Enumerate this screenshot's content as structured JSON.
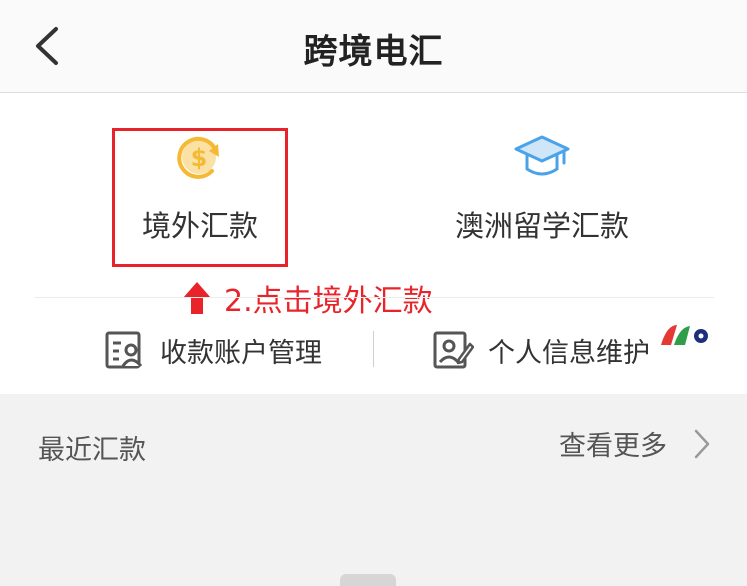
{
  "header": {
    "title": "跨境电汇",
    "back_icon": "chevron-left-icon"
  },
  "services": [
    {
      "label": "境外汇款",
      "icon": "dollar-cycle-icon",
      "color": "#f5b935"
    },
    {
      "label": "澳洲留学汇款",
      "icon": "graduation-cap-icon",
      "color": "#4aa3e8"
    }
  ],
  "annotation": {
    "text": "2.点击境外汇款",
    "color": "#e8242a",
    "icon": "arrow-up-icon"
  },
  "links": [
    {
      "label": "收款账户管理",
      "icon": "contact-card-icon"
    },
    {
      "label": "个人信息维护",
      "icon": "edit-profile-icon"
    }
  ],
  "recent": {
    "title": "最近汇款",
    "more": "查看更多",
    "more_icon": "chevron-right-icon"
  }
}
